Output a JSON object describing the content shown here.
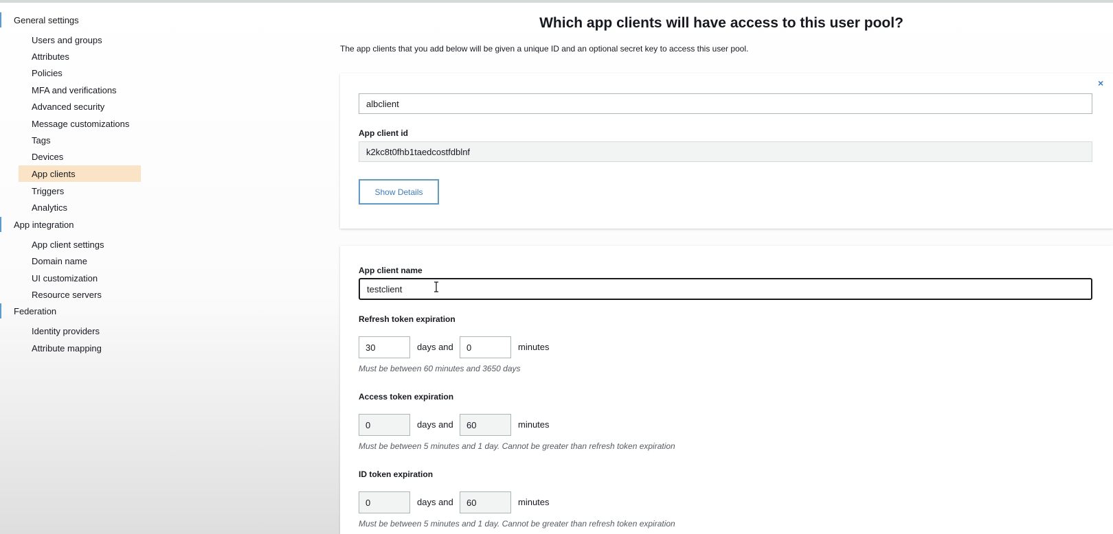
{
  "sidebar": {
    "groups": [
      {
        "label": "General settings"
      },
      {
        "label": "App integration"
      },
      {
        "label": "Federation"
      }
    ],
    "items": [
      {
        "label": "Users and groups"
      },
      {
        "label": "Attributes"
      },
      {
        "label": "Policies"
      },
      {
        "label": "MFA and verifications"
      },
      {
        "label": "Advanced security"
      },
      {
        "label": "Message customizations"
      },
      {
        "label": "Tags"
      },
      {
        "label": "Devices"
      },
      {
        "label": "App clients",
        "active": true
      },
      {
        "label": "Triggers"
      },
      {
        "label": "Analytics"
      },
      {
        "label": "App client settings"
      },
      {
        "label": "Domain name"
      },
      {
        "label": "UI customization"
      },
      {
        "label": "Resource servers"
      },
      {
        "label": "Identity providers"
      },
      {
        "label": "Attribute mapping"
      }
    ]
  },
  "main": {
    "title": "Which app clients will have access to this user pool?",
    "subtitle": "The app clients that you add below will be given a unique ID and an optional secret key to access this user pool."
  },
  "existing_client": {
    "name_value": "albclient",
    "id_label": "App client id",
    "id_value": "k2kc8t0fhb1taedcostfdblnf",
    "show_details_label": "Show Details",
    "close_symbol": "×"
  },
  "new_client": {
    "name_label": "App client name",
    "name_value": "testclient",
    "days_and": "days and",
    "minutes": "minutes",
    "refresh": {
      "label": "Refresh token expiration",
      "days": "30",
      "minutes": "0",
      "hint": "Must be between 60 minutes and 3650 days"
    },
    "access": {
      "label": "Access token expiration",
      "days": "0",
      "minutes": "60",
      "hint": "Must be between 5 minutes and 1 day. Cannot be greater than refresh token expiration"
    },
    "idtoken": {
      "label": "ID token expiration",
      "days": "0",
      "minutes": "60",
      "hint": "Must be between 5 minutes and 1 day. Cannot be greater than refresh token expiration"
    }
  },
  "colors": {
    "accent": "#5a9bd5",
    "active_nav": "#fbe4c6"
  }
}
